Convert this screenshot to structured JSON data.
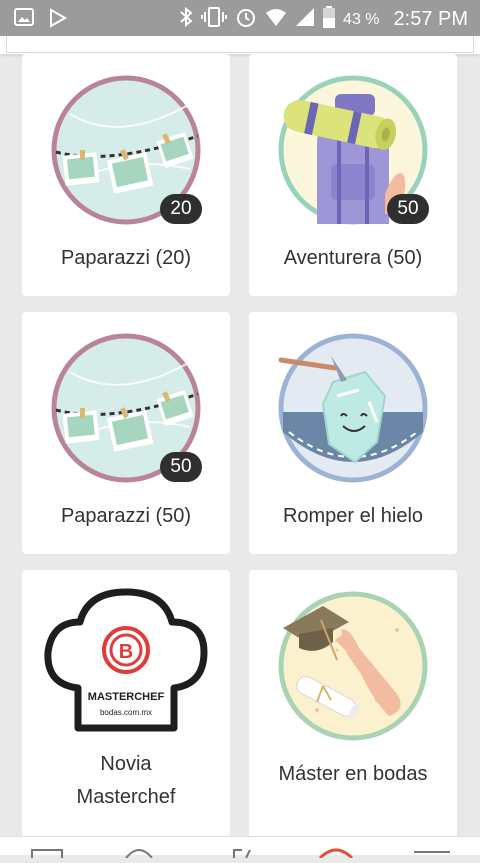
{
  "status_bar": {
    "battery_percent": "43 %",
    "time": "2:57 PM",
    "left_icons": [
      "image-icon",
      "play-store-icon"
    ],
    "right_icons": [
      "bluetooth-icon",
      "vibrate-icon",
      "alarm-icon",
      "wifi-icon",
      "signal-icon",
      "battery-icon"
    ]
  },
  "badges": [
    {
      "label": "Paparazzi (20)",
      "count": "20",
      "icon": "photo-clothesline-badge"
    },
    {
      "label": "Aventurera (50)",
      "count": "50",
      "icon": "backpack-badge"
    },
    {
      "label": "Paparazzi (50)",
      "count": "50",
      "icon": "photo-clothesline-badge"
    },
    {
      "label": "Romper el hielo",
      "icon": "ice-breaker-badge"
    },
    {
      "label_line1": "Novia",
      "label_line2": "Masterchef",
      "icon": "masterchef-badge",
      "logo_text": "MASTERCHEF",
      "logo_subtext": "bodas.com.mx"
    },
    {
      "label": "Máster en bodas",
      "icon": "graduation-badge"
    }
  ],
  "bottom_nav": {
    "items": [
      "messages-icon",
      "chat-icon",
      "tools-icon",
      "profile-icon",
      "menu-icon"
    ],
    "accent_color": "#e74c3c"
  },
  "colors": {
    "status_bar": "#9b9b9b",
    "background": "#e9e9e9",
    "card": "#ffffff",
    "count_badge": "#2f2f2f"
  }
}
